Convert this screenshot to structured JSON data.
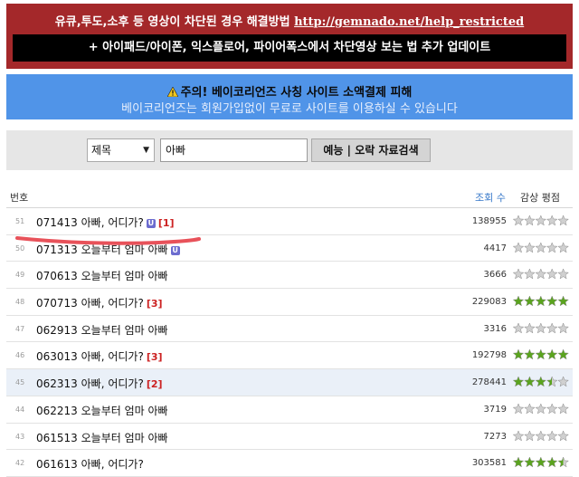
{
  "notice": {
    "line1_text": "유큐,투도,소후 등 영상이 차단된 경우 해결방법 ",
    "line1_link": "http://gemnado.net/help_restricted",
    "line2": "+ 아이패드/아이폰, 익스플로어, 파이어폭스에서 차단영상 보는 법 추가 업데이트"
  },
  "warning": {
    "title": "주의! 베이코리언즈 사칭 사이트 소액결제 피해",
    "subtitle": "베이코리언즈는 회원가입없이 무료로 사이트를 이용하실 수 있습니다"
  },
  "search": {
    "select_value": "제목",
    "query": "아빠",
    "button_label": "예능 | 오락 자료검색"
  },
  "table": {
    "header_no": "번호",
    "header_views": "조회 수",
    "header_rating": "감상 평점",
    "rows": [
      {
        "no": "51",
        "title": "071413 아빠, 어디가?",
        "badge": "U",
        "count": "[1]",
        "views": "138955",
        "stars": 0
      },
      {
        "no": "50",
        "title": "071313 오늘부터 엄마 아빠",
        "badge": "U",
        "count": "",
        "views": "4417",
        "stars": 0
      },
      {
        "no": "49",
        "title": "070613 오늘부터 엄마 아빠",
        "badge": "",
        "count": "",
        "views": "3666",
        "stars": 0
      },
      {
        "no": "48",
        "title": "070713 아빠, 어디가?",
        "badge": "",
        "count": "[3]",
        "views": "229083",
        "stars": 5
      },
      {
        "no": "47",
        "title": "062913 오늘부터 엄마 아빠",
        "badge": "",
        "count": "",
        "views": "3316",
        "stars": 0
      },
      {
        "no": "46",
        "title": "063013 아빠, 어디가?",
        "badge": "",
        "count": "[3]",
        "views": "192798",
        "stars": 5
      },
      {
        "no": "45",
        "title": "062313 아빠, 어디가?",
        "badge": "",
        "count": "[2]",
        "views": "278441",
        "stars": 3.5
      },
      {
        "no": "44",
        "title": "062213 오늘부터 엄마 아빠",
        "badge": "",
        "count": "",
        "views": "3719",
        "stars": 0
      },
      {
        "no": "43",
        "title": "061513 오늘부터 엄마 아빠",
        "badge": "",
        "count": "",
        "views": "7273",
        "stars": 0
      },
      {
        "no": "42",
        "title": "061613 아빠, 어디가?",
        "badge": "",
        "count": "",
        "views": "303581",
        "stars": 4.5
      }
    ]
  },
  "colors": {
    "notice_red": "#a4282a",
    "warning_blue": "#5094e8",
    "star_on": "#5aa41e",
    "star_off": "#d0d0d0",
    "marker": "#e8525a"
  }
}
